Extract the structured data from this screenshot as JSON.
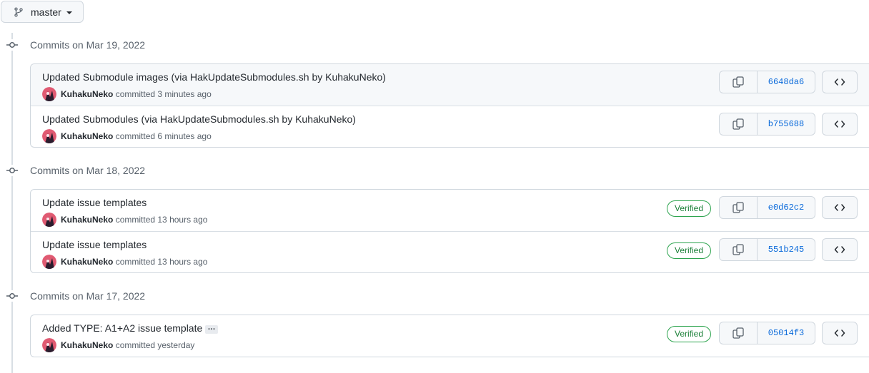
{
  "branch": {
    "label": "master"
  },
  "groups": [
    {
      "title": "Commits on Mar 19, 2022",
      "commits": [
        {
          "message": "Updated Submodule images (via HakUpdateSubmodules.sh by KuhakuNeko)",
          "author": "KuhakuNeko",
          "time": "committed 3 minutes ago",
          "sha": "6648da6",
          "verified": false,
          "highlighted": true
        },
        {
          "message": "Updated Submodules (via HakUpdateSubmodules.sh by KuhakuNeko)",
          "author": "KuhakuNeko",
          "time": "committed 6 minutes ago",
          "sha": "b755688",
          "verified": false
        }
      ]
    },
    {
      "title": "Commits on Mar 18, 2022",
      "commits": [
        {
          "message": "Update issue templates",
          "author": "KuhakuNeko",
          "time": "committed 13 hours ago",
          "sha": "e0d62c2",
          "verified": true,
          "verified_label": "Verified"
        },
        {
          "message": "Update issue templates",
          "author": "KuhakuNeko",
          "time": "committed 13 hours ago",
          "sha": "551b245",
          "verified": true,
          "verified_label": "Verified"
        }
      ]
    },
    {
      "title": "Commits on Mar 17, 2022",
      "commits": [
        {
          "message": "Added TYPE: A1+A2 issue template",
          "author": "KuhakuNeko",
          "time": "committed yesterday",
          "sha": "05014f3",
          "verified": true,
          "verified_label": "Verified",
          "has_more": true,
          "more_label": "…"
        }
      ]
    }
  ],
  "icons": {
    "branch": "git-branch-icon",
    "commit_node": "git-commit-icon",
    "copy": "copy-icon",
    "browse": "code-icon"
  },
  "colors": {
    "link": "#0969da",
    "verified": "#1a7f37",
    "border": "#d0d7de",
    "muted": "#57606a"
  }
}
